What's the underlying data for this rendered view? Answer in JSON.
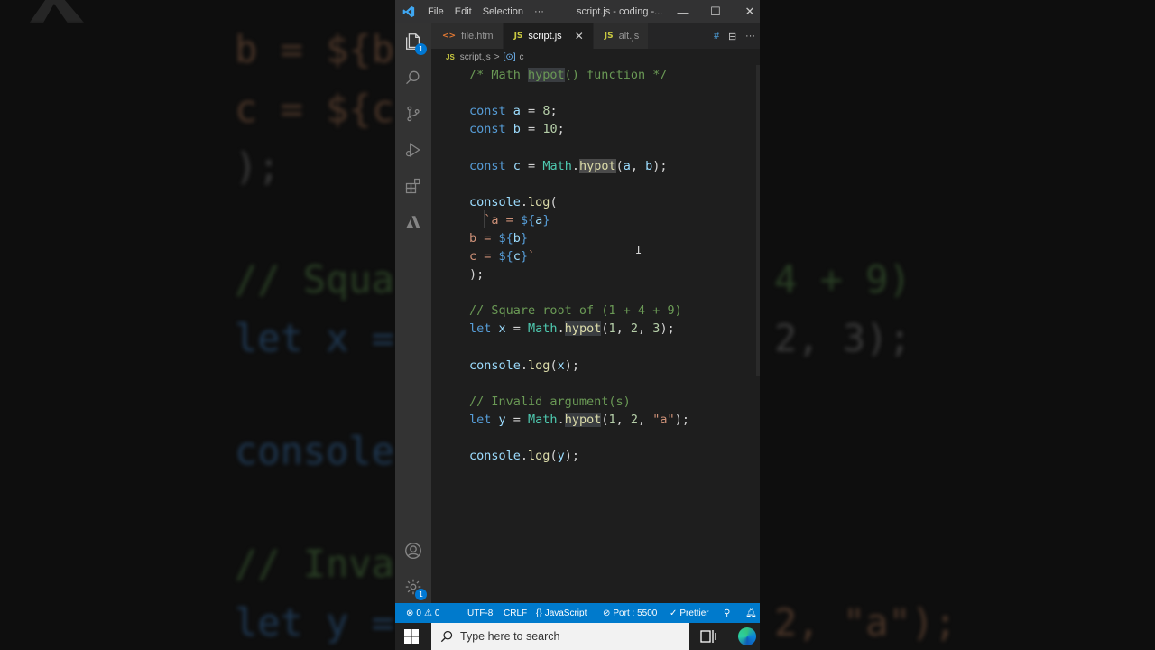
{
  "background_code": {
    "lines": [
      {
        "text": "b = ${b",
        "cls": "c-str"
      },
      {
        "text": "c = ${c",
        "cls": "c-str"
      },
      {
        "text": ");",
        "cls": "c-pun"
      },
      {
        "text": "// Squa",
        "cls": "c-green"
      },
      {
        "text": "let x =",
        "cls": "c-blue"
      },
      {
        "text": "console",
        "cls": "c-blue"
      },
      {
        "text": "// Inva",
        "cls": "c-green"
      },
      {
        "text": "let y =",
        "cls": "c-blue"
      }
    ],
    "right_lines": [
      {
        "text": "4 + 9)",
        "cls": "c-green"
      },
      {
        "text": "2, 3);",
        "cls": "c-pun"
      },
      {
        "text": "2, \"a\");",
        "cls": "c-str"
      }
    ]
  },
  "titlebar": {
    "menu": [
      "File",
      "Edit",
      "Selection",
      "···"
    ],
    "title": "script.js - coding -...",
    "minimize": "—",
    "maximize": "☐",
    "close": "✕"
  },
  "activity_bar": {
    "explorer_badge": "1",
    "settings_badge": "1"
  },
  "tabs": [
    {
      "icon": "<>",
      "icon_type": "html",
      "label": "file.htm",
      "active": false
    },
    {
      "icon": "JS",
      "icon_type": "js",
      "label": "script.js",
      "active": true,
      "close": "✕"
    },
    {
      "icon": "JS",
      "icon_type": "js",
      "label": "alt.js",
      "active": false
    }
  ],
  "tab_actions": [
    "#",
    "⊟",
    "···"
  ],
  "breadcrumb": {
    "file_icon": "JS",
    "file": "script.js",
    "sep": ">",
    "symbol_icon": "[⊙]",
    "symbol": "c"
  },
  "code": [
    [
      [
        "/* Math ",
        "cm"
      ],
      [
        "hypot",
        "cm hl"
      ],
      [
        "() function */",
        "cm"
      ]
    ],
    [],
    [
      [
        "const ",
        "kw"
      ],
      [
        "a",
        "vr"
      ],
      [
        " = ",
        "pn"
      ],
      [
        "8",
        "nm"
      ],
      [
        ";",
        "pn"
      ]
    ],
    [
      [
        "const ",
        "kw"
      ],
      [
        "b",
        "vr"
      ],
      [
        " = ",
        "pn"
      ],
      [
        "10",
        "nm"
      ],
      [
        ";",
        "pn"
      ]
    ],
    [],
    [
      [
        "const ",
        "kw"
      ],
      [
        "c",
        "vr"
      ],
      [
        " = ",
        "pn"
      ],
      [
        "Math",
        "cl"
      ],
      [
        ".",
        "pn"
      ],
      [
        "hypot",
        "fn hl2"
      ],
      [
        "(",
        "pn"
      ],
      [
        "a",
        "vr"
      ],
      [
        ", ",
        "pn"
      ],
      [
        "b",
        "vr"
      ],
      [
        ");",
        "pn"
      ]
    ],
    [],
    [
      [
        "console",
        "vr"
      ],
      [
        ".",
        "pn"
      ],
      [
        "log",
        "fn"
      ],
      [
        "(",
        "pn"
      ]
    ],
    [
      [
        "  `a = ",
        "st"
      ],
      [
        "${",
        "kw"
      ],
      [
        "a",
        "vr"
      ],
      [
        "}",
        "kw"
      ]
    ],
    [
      [
        "b = ",
        "st"
      ],
      [
        "${",
        "kw"
      ],
      [
        "b",
        "vr"
      ],
      [
        "}",
        "kw"
      ]
    ],
    [
      [
        "c = ",
        "st"
      ],
      [
        "${",
        "kw"
      ],
      [
        "c",
        "vr"
      ],
      [
        "}",
        "kw"
      ],
      [
        "`",
        "st"
      ]
    ],
    [
      [
        ");",
        "pn"
      ]
    ],
    [],
    [
      [
        "// Square root of (1 + 4 + 9)",
        "cm"
      ]
    ],
    [
      [
        "let ",
        "kw"
      ],
      [
        "x",
        "vr"
      ],
      [
        " = ",
        "pn"
      ],
      [
        "Math",
        "cl"
      ],
      [
        ".",
        "pn"
      ],
      [
        "hypot",
        "fn hl"
      ],
      [
        "(",
        "pn"
      ],
      [
        "1",
        "nm"
      ],
      [
        ", ",
        "pn"
      ],
      [
        "2",
        "nm"
      ],
      [
        ", ",
        "pn"
      ],
      [
        "3",
        "nm"
      ],
      [
        ");",
        "pn"
      ]
    ],
    [],
    [
      [
        "console",
        "vr"
      ],
      [
        ".",
        "pn"
      ],
      [
        "log",
        "fn"
      ],
      [
        "(",
        "pn"
      ],
      [
        "x",
        "vr"
      ],
      [
        ");",
        "pn"
      ]
    ],
    [],
    [
      [
        "// Invalid argument(s)",
        "cm"
      ]
    ],
    [
      [
        "let ",
        "kw"
      ],
      [
        "y",
        "vr"
      ],
      [
        " = ",
        "pn"
      ],
      [
        "Math",
        "cl"
      ],
      [
        ".",
        "pn"
      ],
      [
        "hypot",
        "fn hl"
      ],
      [
        "(",
        "pn"
      ],
      [
        "1",
        "nm"
      ],
      [
        ", ",
        "pn"
      ],
      [
        "2",
        "nm"
      ],
      [
        ", ",
        "pn"
      ],
      [
        "\"a\"",
        "st"
      ],
      [
        ");",
        "pn"
      ]
    ],
    [],
    [
      [
        "console",
        "vr"
      ],
      [
        ".",
        "pn"
      ],
      [
        "log",
        "fn"
      ],
      [
        "(",
        "pn"
      ],
      [
        "y",
        "vr"
      ],
      [
        ");",
        "pn"
      ]
    ]
  ],
  "statusbar": {
    "errors": "0",
    "warnings": "0",
    "encoding": "UTF-8",
    "eol": "CRLF",
    "language": "JavaScript",
    "port": "Port : 5500",
    "prettier": "Prettier"
  },
  "taskbar": {
    "search_placeholder": "Type here to search"
  }
}
